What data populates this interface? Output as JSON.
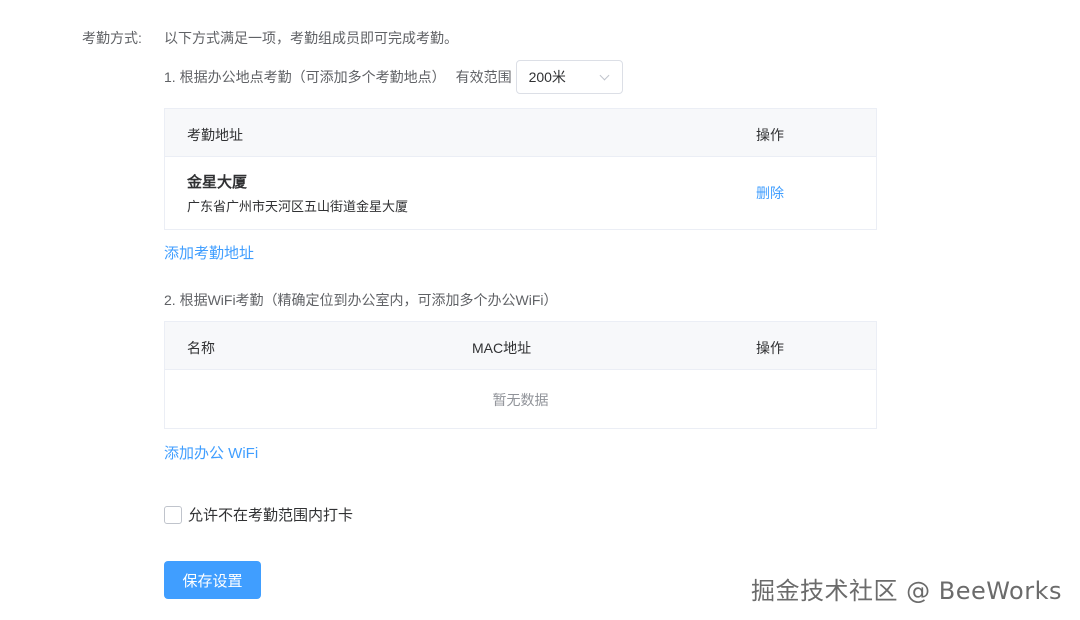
{
  "form": {
    "method_label": "考勤方式:",
    "method_desc": "以下方式满足一项，考勤组成员即可完成考勤。"
  },
  "location": {
    "section_title": "1. 根据办公地点考勤（可添加多个考勤地点）",
    "range_label": "有效范围",
    "range_value": "200米",
    "table": {
      "headers": [
        "考勤地址",
        "操作"
      ],
      "rows": [
        {
          "name": "金星大厦",
          "address": "广东省广州市天河区五山街道金星大厦",
          "action": "删除"
        }
      ]
    },
    "add_link": "添加考勤地址"
  },
  "wifi": {
    "section_title": "2. 根据WiFi考勤（精确定位到办公室内，可添加多个办公WiFi）",
    "table": {
      "headers": [
        "名称",
        "MAC地址",
        "操作"
      ],
      "empty_text": "暂无数据"
    },
    "add_link": "添加办公 WiFi"
  },
  "options": {
    "allow_outside_label": "允许不在考勤范围内打卡",
    "allow_outside_checked": false
  },
  "actions": {
    "save_label": "保存设置"
  },
  "watermark": "掘金技术社区 @ BeeWorks",
  "colors": {
    "primary": "#409eff",
    "table_header_bg": "#f7f8fa",
    "border": "#ebeef5"
  }
}
